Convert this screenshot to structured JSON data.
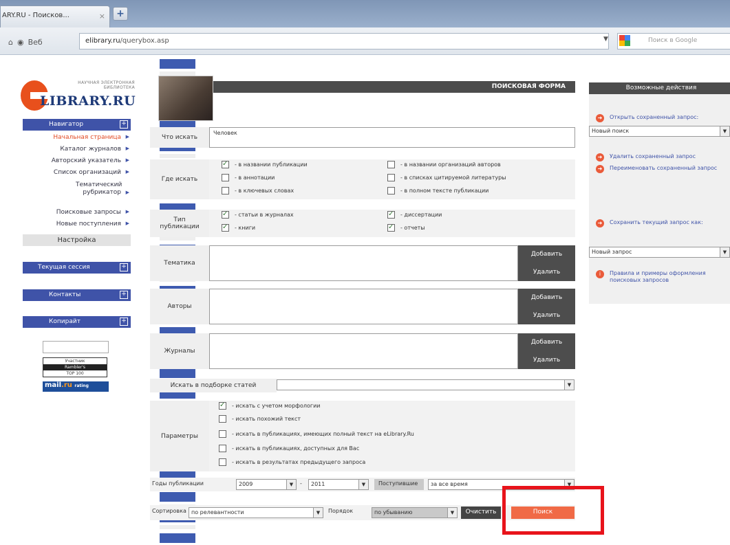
{
  "browser": {
    "tab_title": "ARY.RU - Поисков...",
    "tab_close": "×",
    "new_tab": "+",
    "back_label": "Веб",
    "url_domain": "elibrary.ru",
    "url_path": "/querybox.asp",
    "search_placeholder": "Поиск в Google"
  },
  "logo": {
    "top_line1": "НАУЧНАЯ ЭЛЕКТРОННАЯ",
    "top_line2": "БИБЛИОТЕКА",
    "main": "LIBRARY.RU"
  },
  "sidebar": {
    "navigator": "Навигатор",
    "items": [
      {
        "label": "Начальная страница",
        "active": true
      },
      {
        "label": "Каталог журналов",
        "active": false
      },
      {
        "label": "Авторский указатель",
        "active": false
      },
      {
        "label": "Список организаций",
        "active": false
      },
      {
        "label": "Тематический рубрикатор",
        "active": false
      },
      {
        "label": "Поисковые запросы",
        "active": false
      },
      {
        "label": "Новые поступления",
        "active": false
      }
    ],
    "settings": "Настройка",
    "session": "Текущая сессия",
    "contacts": "Контакты",
    "copyright": "Копирайт",
    "toggle": "+",
    "rating_line1": "Участник",
    "rating_line2": "Rambler's",
    "rating_line3": "TOP 100",
    "mail_logo": "mail",
    "mail_suffix": ".ru",
    "mail_tag": "rating"
  },
  "form": {
    "title": "ПОИСКОВАЯ ФОРМА",
    "what_label": "Что искать",
    "what_value": "Человек",
    "where_label": "Где искать",
    "where_options": [
      {
        "label": "- в названии публикации",
        "checked": true
      },
      {
        "label": "- в аннотации",
        "checked": false
      },
      {
        "label": "- в ключевых словах",
        "checked": false
      },
      {
        "label": "- в названии организаций авторов",
        "checked": false
      },
      {
        "label": "- в списках цитируемой литературы",
        "checked": false
      },
      {
        "label": "- в полном тексте публикации",
        "checked": false
      }
    ],
    "type_label_1": "Тип",
    "type_label_2": "публикации",
    "type_options": [
      {
        "label": "- статьи в журналах",
        "checked": true
      },
      {
        "label": "- книги",
        "checked": true
      },
      {
        "label": "- диссертации",
        "checked": true
      },
      {
        "label": "- отчеты",
        "checked": true
      }
    ],
    "topic_label": "Тематика",
    "authors_label": "Авторы",
    "journals_label": "Журналы",
    "add_label": "Добавить",
    "remove_label": "Удалить",
    "collection_label": "Искать в подборке статей",
    "params_label": "Параметры",
    "params_options": [
      {
        "label": "- искать с учетом морфологии",
        "checked": true
      },
      {
        "label": "- искать похожий текст",
        "checked": false
      },
      {
        "label": "- искать в публикациях, имеющих полный текст на eLibrary.Ru",
        "checked": false
      },
      {
        "label": "- искать в публикациях, доступных для Вас",
        "checked": false
      },
      {
        "label": "- искать в результатах предыдущего запроса",
        "checked": false
      }
    ],
    "years_label": "Годы публикации",
    "year_from": "2009",
    "year_to": "2011",
    "dash": "-",
    "received_label": "Поступившие",
    "received_value": "за все время",
    "sort_label": "Сортировка",
    "sort_value": "по релевантности",
    "order_label": "Порядок",
    "order_value": "по убыванию",
    "clear_label": "Очистить",
    "search_label": "Поиск",
    "arrow": "▼"
  },
  "actions": {
    "title": "Возможные действия",
    "open_saved": "Открыть сохраненный запрос:",
    "new_search": "Новый поиск",
    "delete_saved": "Удалить сохраненный запрос",
    "rename_saved": "Переименовать сохраненный запрос",
    "save_current": "Сохранить текущий запрос как:",
    "new_query": "Новый запрос",
    "rules": "Правила и примеры оформления поисковых запросов"
  },
  "colors": {
    "accent": "#3f53a8",
    "search_button": "#f06a46",
    "highlight": "#e8131b"
  }
}
